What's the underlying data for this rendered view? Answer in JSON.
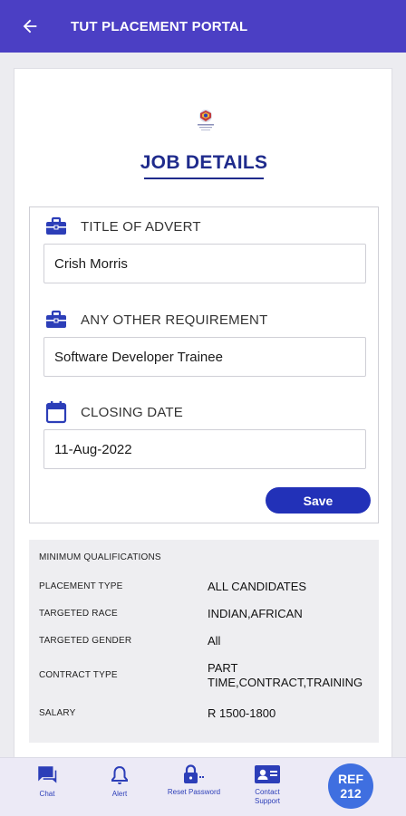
{
  "header": {
    "title": "TUT PLACEMENT PORTAL",
    "back_icon": "arrow-left-icon"
  },
  "page": {
    "heading": "JOB DETAILS"
  },
  "form": {
    "title_of_advert": {
      "label": "TITLE OF ADVERT",
      "value": "Crish Morris",
      "icon": "briefcase-icon"
    },
    "other_requirement": {
      "label": "ANY OTHER REQUIREMENT",
      "value": "Software Developer Trainee",
      "icon": "briefcase-icon"
    },
    "closing_date": {
      "label": "CLOSING DATE",
      "value": "11-Aug-2022",
      "icon": "calendar-icon"
    },
    "save_label": "Save"
  },
  "summary": {
    "heading": "MINIMUM QUALIFICATIONS",
    "rows": [
      {
        "key": "PLACEMENT TYPE",
        "value": "ALL CANDIDATES"
      },
      {
        "key": "TARGETED RACE",
        "value": "INDIAN,AFRICAN"
      },
      {
        "key": "TARGETED GENDER",
        "value": "All"
      },
      {
        "key": "CONTRACT TYPE",
        "value": "PART TIME,CONTRACT,TRAINING"
      },
      {
        "key": "SALARY",
        "value": "R 1500-1800"
      }
    ]
  },
  "bottom_nav": {
    "items": [
      {
        "label": "Chat",
        "icon": "chat-icon"
      },
      {
        "label": "Alert",
        "icon": "bell-icon"
      },
      {
        "label": "Reset Password",
        "icon": "lock-icon"
      },
      {
        "label": "Contact Support",
        "icon": "contact-card-icon"
      }
    ],
    "ref": {
      "line1": "REF",
      "line2": "212"
    }
  },
  "colors": {
    "appbar": "#4b3fc4",
    "heading": "#1f2b8c",
    "save_button": "#2231b8",
    "icon": "#2c3eb8",
    "ref_badge": "#3f6fe0"
  }
}
